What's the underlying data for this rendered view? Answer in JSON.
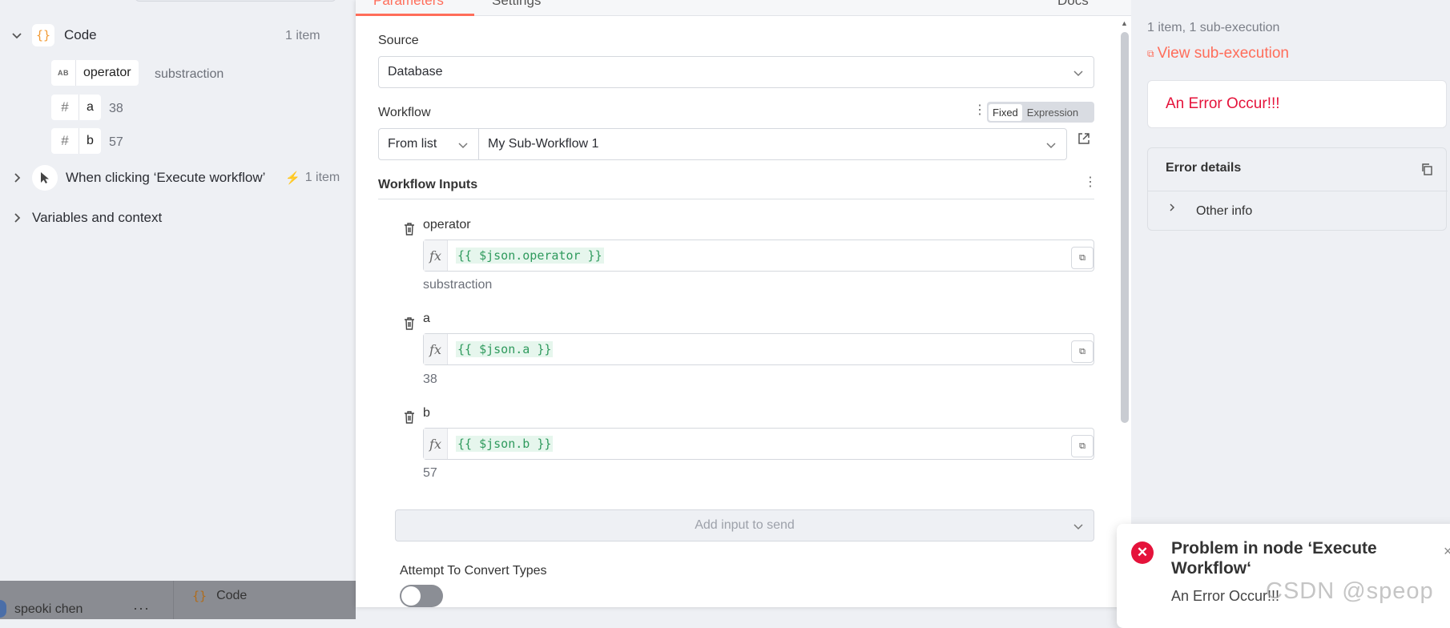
{
  "left": {
    "code_node": {
      "label": "Code",
      "count": "1 item",
      "icon": "curly-braces-icon"
    },
    "fields": [
      {
        "type": "AB",
        "name": "operator",
        "value": "substraction"
      },
      {
        "type": "#",
        "name": "a",
        "value": "38"
      },
      {
        "type": "#",
        "name": "b",
        "value": "57"
      }
    ],
    "trigger_node": {
      "label": "When clicking ‘Execute workflow’",
      "count": "1 item"
    },
    "variables": "Variables and context",
    "bottom": {
      "user": "speoki chen",
      "more": "···",
      "code_label": "Code",
      "code_icon": "{}"
    }
  },
  "main": {
    "tabs": [
      "Parameters",
      "Settings",
      "Docs"
    ],
    "source": {
      "label": "Source",
      "value": "Database"
    },
    "workflow": {
      "label": "Workflow",
      "mode_fixed": "Fixed",
      "mode_expression": "Expression",
      "from": "From list",
      "value": "My Sub-Workflow 1"
    },
    "inputs_title": "Workflow Inputs",
    "inputs": [
      {
        "name": "operator",
        "expression": "{{ $json.operator }}",
        "result": "substraction"
      },
      {
        "name": "a",
        "expression": "{{ $json.a }}",
        "result": "38"
      },
      {
        "name": "b",
        "expression": "{{ $json.b }}",
        "result": "57"
      }
    ],
    "fx_label": "fx",
    "add_input": "Add input to send",
    "convert_label": "Attempt To Convert Types",
    "convert_on": false
  },
  "right": {
    "summary": "1 item, 1 sub-execution",
    "view_sub": "View sub-execution",
    "error_message": "An Error Occur!!!",
    "details_title": "Error details",
    "other_info": "Other info"
  },
  "toast": {
    "title": "Problem in node ‘Execute Workflow‘",
    "message": "An Error Occur!!!",
    "close": "×"
  },
  "watermark": "CSDN @speop",
  "colors": {
    "accent": "#ff6d5a",
    "error": "#e5133b",
    "expression_green": "#2f9a5d"
  }
}
